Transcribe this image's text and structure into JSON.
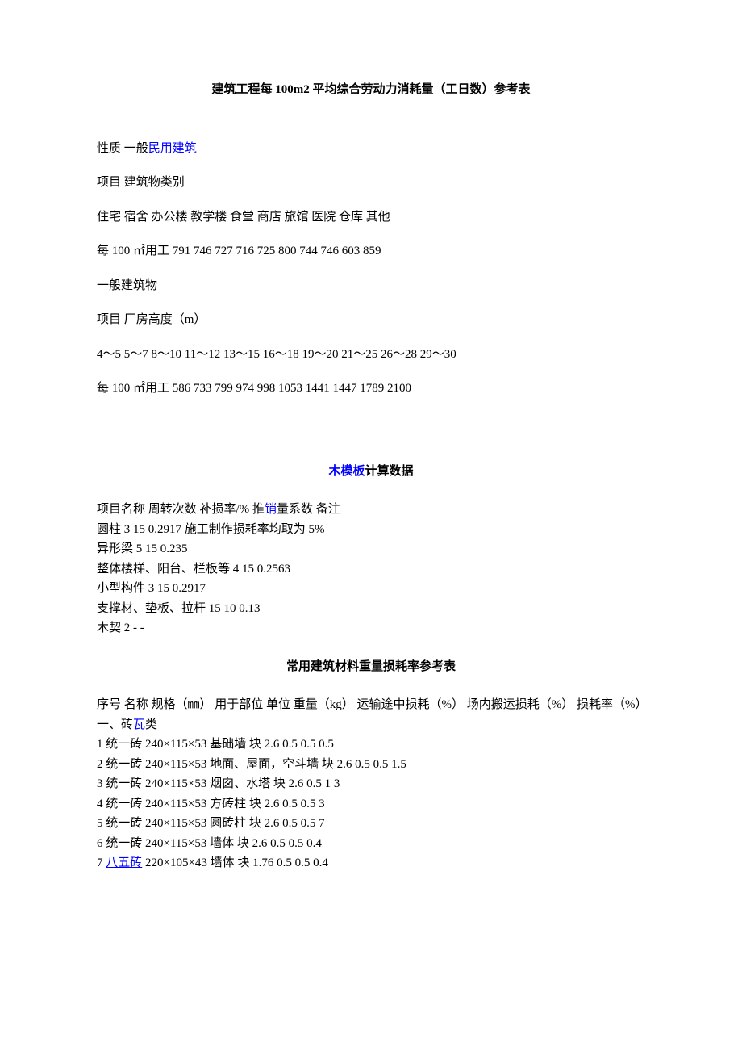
{
  "title1": "建筑工程每 100m2 平均综合劳动力消耗量（工日数）参考表",
  "line_nature_prefix": "性质  一般",
  "link_civil": "民用建筑",
  "line_item_category": "项目  建筑物类别",
  "line_building_types": "住宅  宿舍  办公楼  教学楼  食堂  商店  旅馆  医院  仓库  其他",
  "line_per100_1": "每 100 ㎡用工  791  746  727  716  725  800  744  746  603  859",
  "line_general_building": "一般建筑物",
  "line_item_height": "项目  厂房高度（m）",
  "line_height_ranges": "4～5  5～7  8～10  11～12  13～15  16～18  19～20  21～25  26～28  29～30",
  "line_per100_2": "每 100 ㎡用工  586  733  799  974  998  1053  1441  1447  1789  2100",
  "title2_link": "木模板",
  "title2_suffix": "计算数据",
  "wf_header": "项目名称  周转次数  补损率/%  推",
  "wf_header_link": "销",
  "wf_header_suffix": "量系数  备注",
  "wf_row1": "圆柱  3 15 0.2917  施工制作损耗率均取为 5%",
  "wf_row2": "异形梁  5 15 0.235",
  "wf_row3": "整体楼梯、阳台、栏板等  4 15 0.2563",
  "wf_row4": "小型构件  3 15 0.2917",
  "wf_row5": "支撑材、垫板、拉杆  15 10 0.13",
  "wf_row6": "木契  2 - -",
  "title3": "常用建筑材料重量损耗率参考表",
  "mat_header": "序号  名称  规格（㎜）  用于部位  单位  重量（kg）  运输途中损耗（%）  场内搬运损耗（%）  损耗率（%）",
  "mat_cat1_prefix": "一、砖",
  "mat_cat1_link": "瓦",
  "mat_cat1_suffix": "类",
  "mat_r1": "1  统一砖  240×115×53  基础墙  块  2.6 0.5 0.5 0.5",
  "mat_r2": "2  统一砖  240×115×53  地面、屋面，空斗墙  块  2.6 0.5 0.5 1.5",
  "mat_r3": "3  统一砖  240×115×53  烟囱、水塔  块  2.6 0.5 1 3",
  "mat_r4": "4  统一砖  240×115×53  方砖柱  块  2.6 0.5 0.5 3",
  "mat_r5": "5  统一砖  240×115×53  圆砖柱  块  2.6 0.5 0.5 7",
  "mat_r6": "6  统一砖  240×115×53  墙体  块  2.6 0.5 0.5 0.4",
  "mat_r7_prefix": "7  ",
  "mat_r7_link": "八五砖",
  "mat_r7_suffix": "  220×105×43  墙体  块  1.76 0.5 0.5 0.4"
}
